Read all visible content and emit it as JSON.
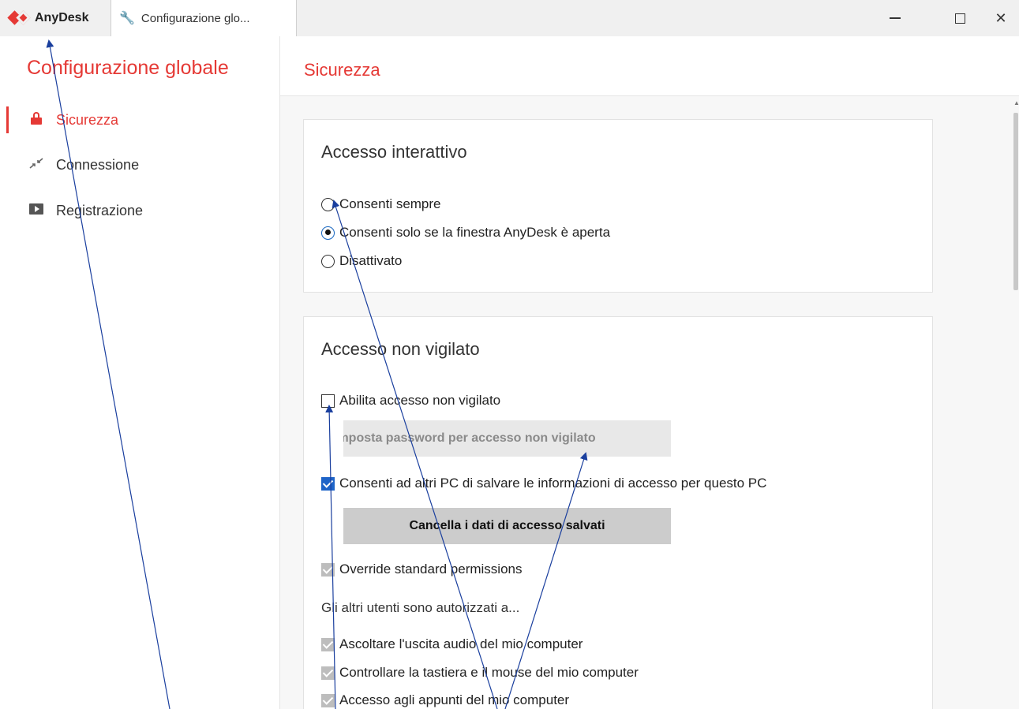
{
  "titlebar": {
    "app_name": "AnyDesk",
    "tab_label": "Configurazione glo...",
    "window_controls": [
      "minimize-icon",
      "maximize-icon",
      "close-icon"
    ]
  },
  "sidebar": {
    "title": "Configurazione globale",
    "items": [
      {
        "label": "Sicurezza",
        "icon": "lock-icon",
        "active": true
      },
      {
        "label": "Connessione",
        "icon": "connection-icon",
        "active": false
      },
      {
        "label": "Registrazione",
        "icon": "recording-icon",
        "active": false
      }
    ]
  },
  "main": {
    "title": "Sicurezza",
    "interactive": {
      "title": "Accesso interattivo",
      "options": [
        {
          "label": "Consenti sempre",
          "checked": false
        },
        {
          "label": "Consenti solo se la finestra AnyDesk è aperta",
          "checked": true
        },
        {
          "label": "Disattivato",
          "checked": false
        }
      ]
    },
    "unattended": {
      "title": "Accesso non vigilato",
      "enable_label": "Abilita accesso non vigilato",
      "set_password_button": "Imposta password per accesso non vigilato",
      "save_info_label": "Consenti ad altri PC di salvare le informazioni di accesso per questo PC",
      "clear_button": "Cancella i dati di accesso salvati",
      "override_label": "Override standard permissions",
      "others_text": "Gli altri utenti sono autorizzati a...",
      "permissions": [
        "Ascoltare l'uscita audio del mio computer",
        "Controllare la tastiera e il mouse del mio computer",
        "Accesso agli appunti del mio computer"
      ]
    }
  },
  "colors": {
    "accent": "#e53935",
    "checkbox_on": "#1e64c8",
    "annotation_arrow": "#1a3f9e"
  }
}
